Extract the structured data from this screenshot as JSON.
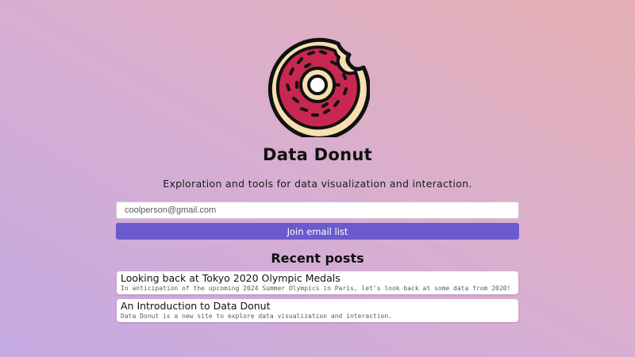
{
  "site": {
    "title": "Data Donut",
    "tagline": "Exploration and tools for data visualization and interaction.",
    "logo_icon": "donut-icon"
  },
  "signup": {
    "email_placeholder": "coolperson@gmail.com",
    "join_label": "Join email list"
  },
  "recent": {
    "heading": "Recent posts",
    "posts": [
      {
        "title": "Looking back at Tokyo 2020 Olympic Medals",
        "excerpt": "In anticipation of the upcoming 2024 Summer Olympics in Paris, let's look back at some data from 2020!"
      },
      {
        "title": "An Introduction to Data Donut",
        "excerpt": "Data Donut is a new site to explore data visualization and interaction."
      }
    ]
  },
  "colors": {
    "accent": "#6a5acd",
    "icing": "#c8284f",
    "dough": "#f8dfb0",
    "outline": "#111111"
  }
}
